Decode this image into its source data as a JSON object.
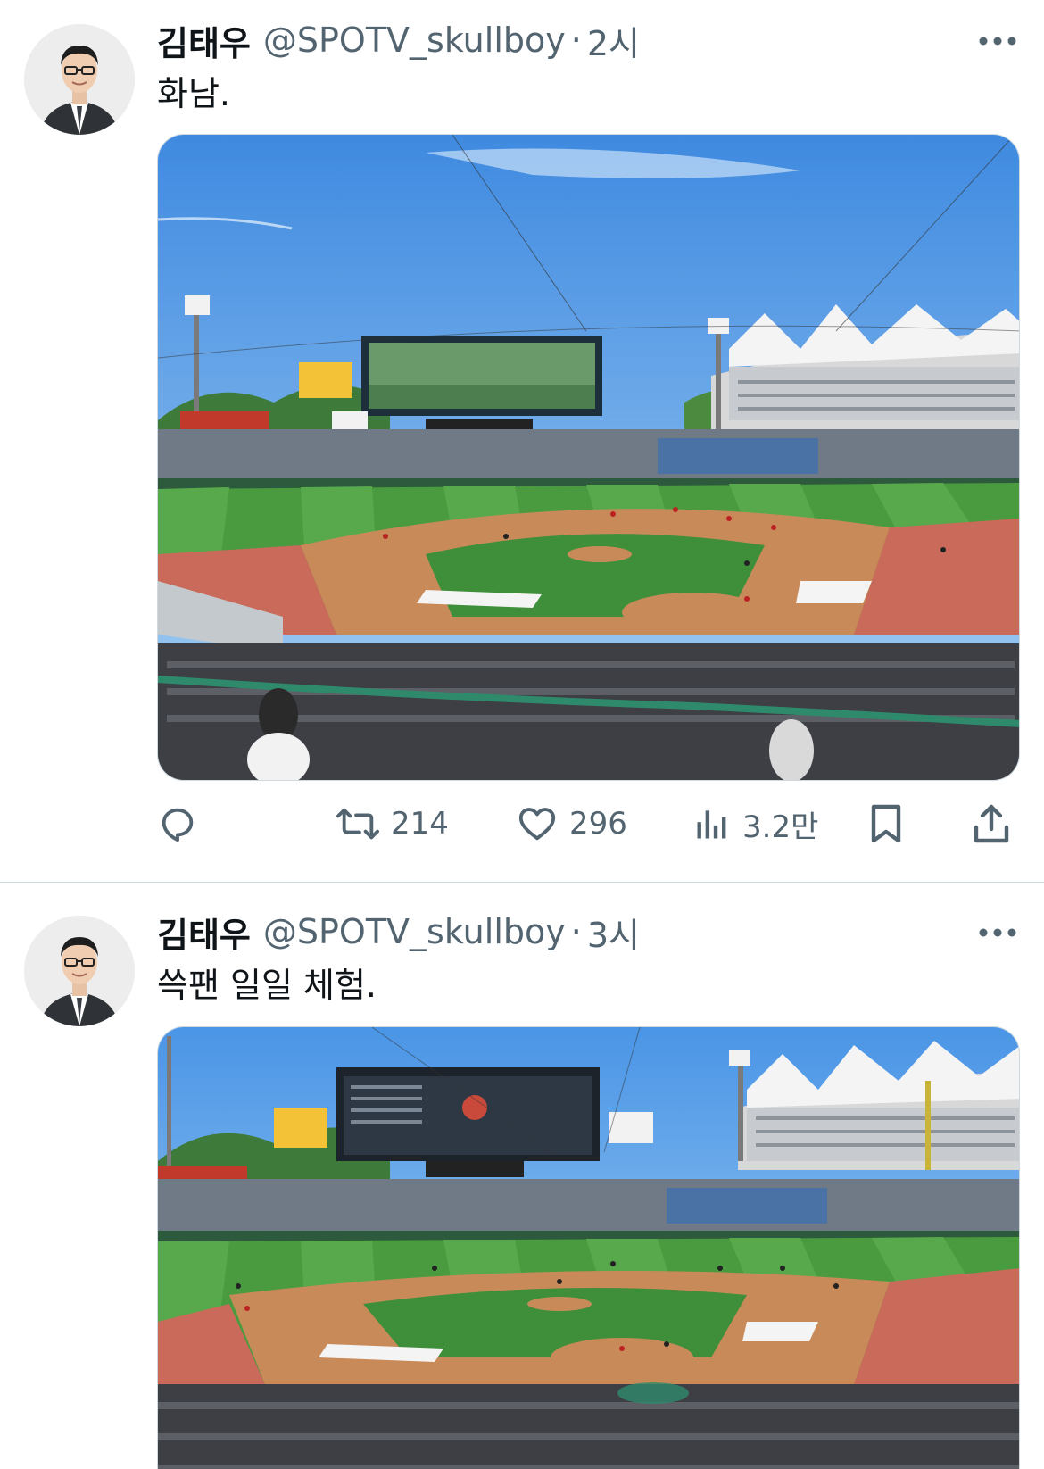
{
  "tweets": [
    {
      "author_name": "김태우",
      "handle": "@SPOTV_skullboy",
      "separator": "·",
      "time": "2시",
      "text": "화남.",
      "more_icon": "more-horizontal-icon",
      "actions": {
        "reply_icon": "reply-icon",
        "retweet_icon": "retweet-icon",
        "retweet_count": "214",
        "like_icon": "heart-icon",
        "like_count": "296",
        "views_icon": "views-chart-icon",
        "views_count": "3.2만",
        "bookmark_icon": "bookmark-icon",
        "share_icon": "share-icon"
      }
    },
    {
      "author_name": "김태우",
      "handle": "@SPOTV_skullboy",
      "separator": "·",
      "time": "3시",
      "text": "쓱팬 일일 체험.",
      "more_icon": "more-horizontal-icon"
    }
  ],
  "colors": {
    "text_primary": "#0f1419",
    "text_secondary": "#536471",
    "divider": "#cfd9de",
    "sky": "#5a9ee0",
    "grass": "#3f8f3a",
    "dirt": "#c98a5a"
  }
}
